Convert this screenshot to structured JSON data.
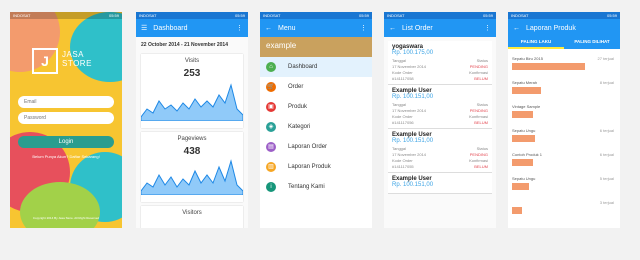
{
  "status": {
    "carrier": "INDOSAT",
    "time": "05:59"
  },
  "login": {
    "logo_char": "J",
    "brand_line1": "JASA",
    "brand_line2": "STORE",
    "email_placeholder": "Email",
    "password_placeholder": "Password",
    "login_button": "Login",
    "links": "Belum Punya Akun? Daftar Sekarang!",
    "footer": "Copyright 2014 By Jasa Store. All Right Reserved"
  },
  "dashboard": {
    "title": "Dashboard",
    "date_range": "22 October 2014 - 21 November 2014",
    "visits_label": "Visits",
    "visits_value": "253",
    "pageviews_label": "Pageviews",
    "pageviews_value": "438",
    "visitors_label": "Visitors"
  },
  "menu": {
    "title": "Menu",
    "store": "example",
    "items": [
      {
        "label": "Dashboard",
        "color": "#4caf50"
      },
      {
        "label": "Order",
        "color": "#ef6c00"
      },
      {
        "label": "Produk",
        "color": "#e53935"
      },
      {
        "label": "Kategori",
        "color": "#2ba198"
      },
      {
        "label": "Laporan Order",
        "color": "#9c5fc7"
      },
      {
        "label": "Laporan Produk",
        "color": "#f6a623"
      },
      {
        "label": "Tentang Kami",
        "color": "#17967a"
      }
    ]
  },
  "orders": {
    "title": "List Order",
    "labels": {
      "tanggal": "Tanggal",
      "status": "Status",
      "kode": "Kode Order",
      "konf": "Konfirmasi"
    },
    "items": [
      {
        "name": "yogaswara",
        "price": "Rp. 100.175,00",
        "date": "17 November 2014",
        "status": "PENDING",
        "code": "#141117058",
        "konf": "BELUM"
      },
      {
        "name": "Example User",
        "price": "Rp. 100.151,00",
        "date": "17 November 2014",
        "status": "PENDING",
        "code": "#141117056",
        "konf": "BELUM"
      },
      {
        "name": "Example User",
        "price": "Rp. 100.151,00",
        "date": "17 November 2014",
        "status": "PENDING",
        "code": "#141117055",
        "konf": "BELUM"
      },
      {
        "name": "Example User",
        "price": "Rp. 100.151,00"
      }
    ]
  },
  "report": {
    "title": "Laporan Produk",
    "tabs": [
      "PALING LAKU",
      "PALING DILIHAT"
    ],
    "items": [
      {
        "name": "Sepatu Biru 2015",
        "count": "27 terjual",
        "level": 0.7
      },
      {
        "name": "Sepatu Merah",
        "count": "8 terjual",
        "level": 0.28
      },
      {
        "name": "Vintage Sample",
        "count": "",
        "level": 0.2
      },
      {
        "name": "Sepatu Ungu",
        "count": "6 terjual",
        "level": 0.22
      },
      {
        "name": "Contoh Produk 1",
        "count": "6 terjual",
        "level": 0.2
      },
      {
        "name": "Sepatu Ungu",
        "count": "5 terjual",
        "level": 0.16
      },
      {
        "name": "",
        "count": "3 terjual",
        "level": 0.1
      }
    ]
  },
  "colors": {
    "blue": "#2196f3",
    "teal": "#26a69a"
  }
}
